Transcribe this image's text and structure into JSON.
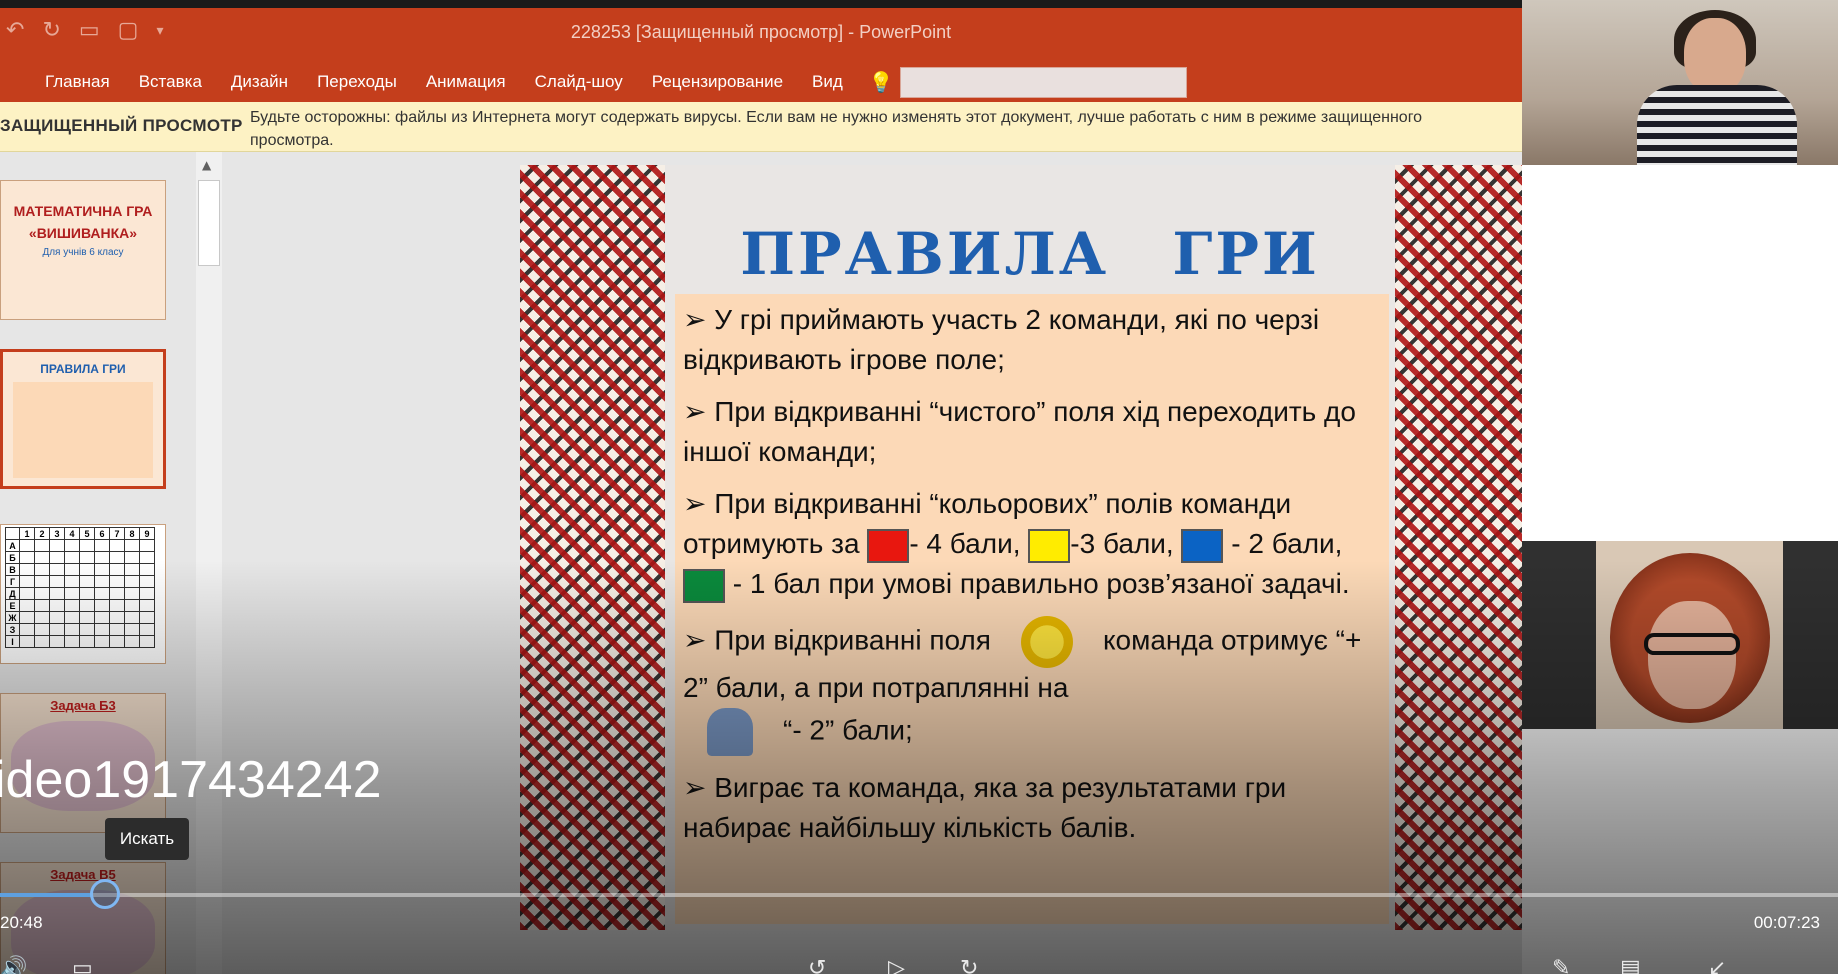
{
  "window": {
    "title": "228253 [Защищенный просмотр] - PowerPoint",
    "qat_icons": [
      "undo-icon",
      "redo-icon",
      "slideshow-from-start-icon",
      "print-preview-icon",
      "customize-qat-icon"
    ]
  },
  "ribbon": {
    "tabs": [
      "Главная",
      "Вставка",
      "Дизайн",
      "Переходы",
      "Анимация",
      "Слайд-шоу",
      "Рецензирование",
      "Вид"
    ],
    "tell_me_icon": "lightbulb-icon"
  },
  "protected_view": {
    "label": "ЗАЩИЩЕННЫЙ ПРОСМОТР",
    "message": "Будьте осторожны: файлы из Интернета могут содержать вирусы. Если вам не нужно изменять этот документ, лучше работать с ним в режиме защищенного просмотра."
  },
  "thumbnails": [
    {
      "title": "МАТЕМАТИЧНА ГРА",
      "subtitle": "«ВИШИВАНКА»",
      "note": "Для учнів 6 класу"
    },
    {
      "title": "ПРАВИЛА ГРИ",
      "selected": true
    },
    {
      "header_row": [
        "1",
        "2",
        "3",
        "4",
        "5",
        "6",
        "7",
        "8",
        "9"
      ],
      "row_labels": [
        "А",
        "Б",
        "В",
        "Г",
        "Д",
        "Е",
        "Ж",
        "З",
        "І"
      ]
    },
    {
      "title": "Задача Б3"
    },
    {
      "title": "Задача В5"
    }
  ],
  "slide": {
    "title": "ПРАВИЛА ГРИ",
    "rule1": "➢ У грі приймають участь 2 команди, які по черзі відкривають ігрове поле;",
    "rule2": "➢ При відкриванні “чистого” поля хід переходить до іншої команди;",
    "rule3_a": "➢ При відкриванні “кольорових” полів команди отримують за",
    "rule3_b": "- 4 бали,",
    "rule3_c": "-3 бали,",
    "rule3_d": "- 2 бали,",
    "rule3_e": "- 1 бал при умові правильно розв’язаної задачі.",
    "rule4_a": "➢ При відкриванні поля",
    "rule4_b": "команда отримує “+ 2” бали, а при потраплянні на",
    "rule4_c": "“- 2” бали;",
    "rule5": "➢ Виграє та команда, яка за результатами гри набирає найбільшу кількість балів.",
    "colors": {
      "red": "#e8170f",
      "yellow": "#ffec00",
      "blue": "#0b63c4",
      "green": "#0a8a3c"
    }
  },
  "player": {
    "video_name": "ideo1917434242",
    "tooltip": "Искать",
    "elapsed": "20:48",
    "remaining": "00:07:23",
    "progress": 0.05,
    "controls": [
      "volume-icon",
      "window-icon",
      "rewind-icon",
      "play-icon",
      "forward-icon",
      "edit-icon",
      "captions-icon",
      "collapse-icon"
    ]
  }
}
